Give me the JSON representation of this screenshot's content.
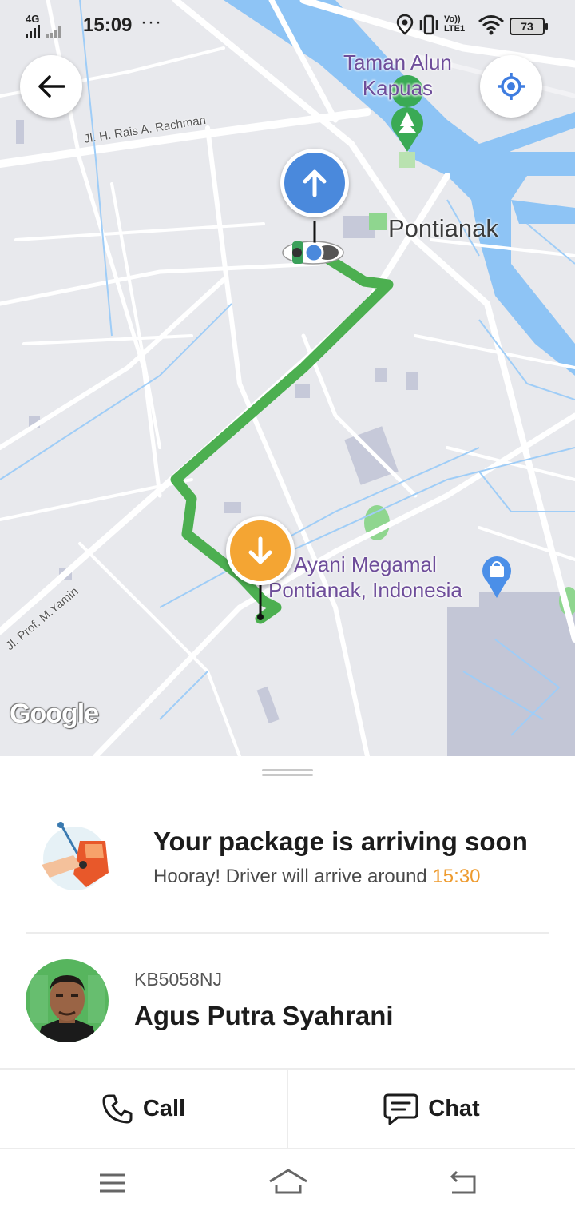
{
  "status_bar": {
    "network": "4G",
    "time": "15:09",
    "dots": "···",
    "lte": "Vo)) LTE1",
    "battery": "73"
  },
  "map": {
    "poi_park": "Taman Alun\nKapuas",
    "city": "Pontianak",
    "poi_mall": "Ayani Megamal\nPontianak, Indonesia",
    "road_1": "Jl. H. Rais A. Rachman",
    "road_2": "Jl. Prof. M.Yamin",
    "attribution": "Google",
    "route_color": "#4caf50",
    "pickup_color": "#4a89dc",
    "dropoff_color": "#f4a533"
  },
  "sheet": {
    "status_title": "Your package is arriving soon",
    "status_sub_prefix": "Hooray! Driver will arrive around ",
    "eta": "15:30",
    "plate": "KB5058NJ",
    "driver_name": "Agus Putra Syahrani",
    "call_label": "Call",
    "chat_label": "Chat"
  }
}
